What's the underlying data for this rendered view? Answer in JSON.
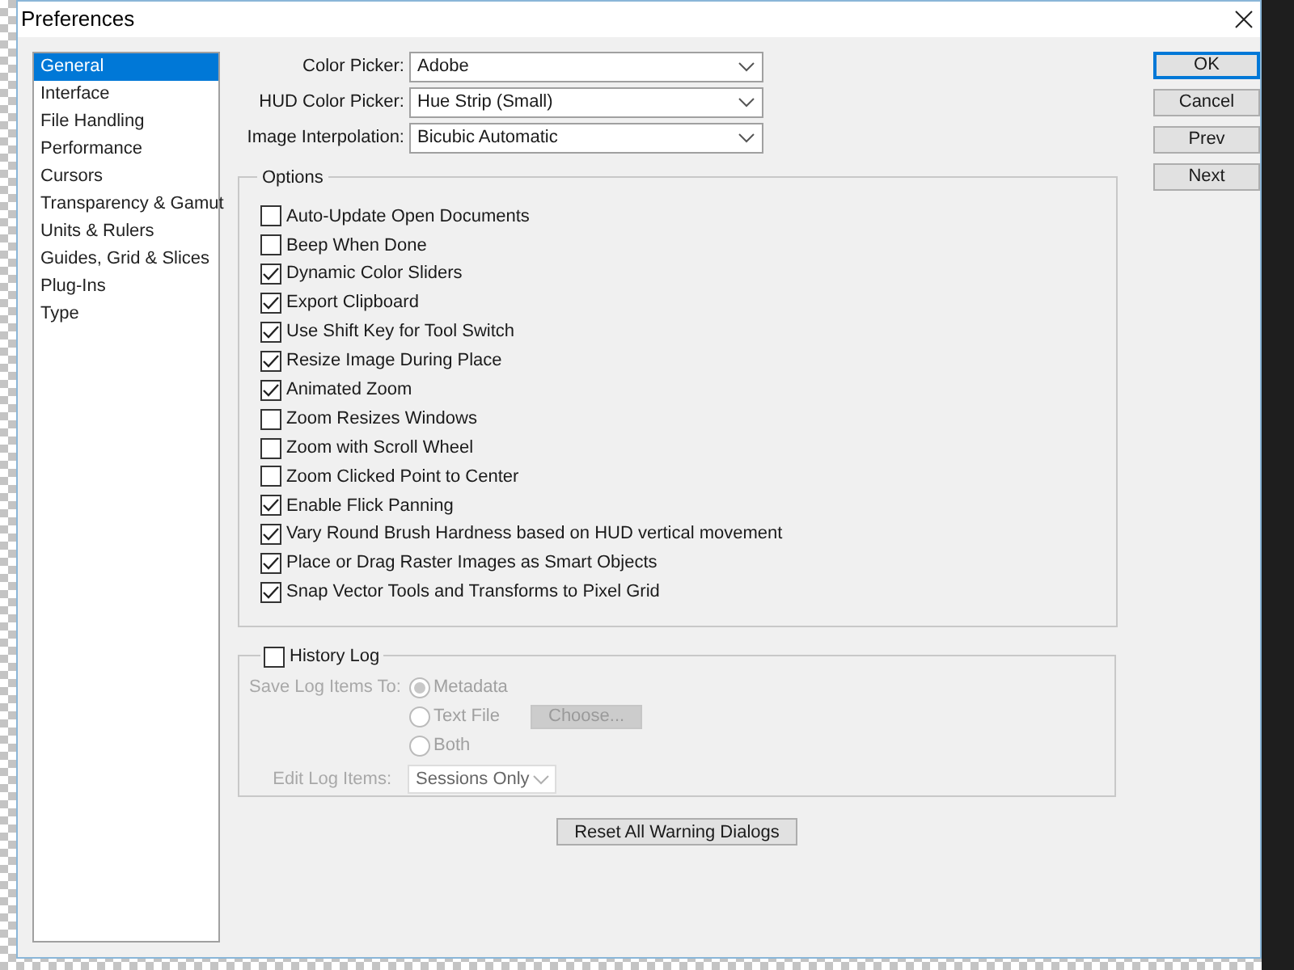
{
  "window": {
    "title": "Preferences"
  },
  "sidebar": {
    "items": [
      {
        "label": "General",
        "selected": true
      },
      {
        "label": "Interface",
        "selected": false
      },
      {
        "label": "File Handling",
        "selected": false
      },
      {
        "label": "Performance",
        "selected": false
      },
      {
        "label": "Cursors",
        "selected": false
      },
      {
        "label": "Transparency & Gamut",
        "selected": false
      },
      {
        "label": "Units & Rulers",
        "selected": false
      },
      {
        "label": "Guides, Grid & Slices",
        "selected": false
      },
      {
        "label": "Plug-Ins",
        "selected": false
      },
      {
        "label": "Type",
        "selected": false
      }
    ]
  },
  "pickers": [
    {
      "label": "Color Picker:",
      "value": "Adobe"
    },
    {
      "label": "HUD Color Picker:",
      "value": "Hue Strip (Small)"
    },
    {
      "label": "Image Interpolation:",
      "value": "Bicubic Automatic"
    }
  ],
  "options": {
    "title": "Options",
    "items": [
      {
        "label": "Auto-Update Open Documents",
        "checked": false
      },
      {
        "label": "Beep When Done",
        "checked": false
      },
      {
        "label": "Dynamic Color Sliders",
        "checked": true
      },
      {
        "label": "Export Clipboard",
        "checked": true
      },
      {
        "label": "Use Shift Key for Tool Switch",
        "checked": true
      },
      {
        "label": "Resize Image During Place",
        "checked": true
      },
      {
        "label": "Animated Zoom",
        "checked": true
      },
      {
        "label": "Zoom Resizes Windows",
        "checked": false
      },
      {
        "label": "Zoom with Scroll Wheel",
        "checked": false
      },
      {
        "label": "Zoom Clicked Point to Center",
        "checked": false
      },
      {
        "label": "Enable Flick Panning",
        "checked": true
      },
      {
        "label": "Vary Round Brush Hardness based on HUD vertical movement",
        "checked": true
      },
      {
        "label": "Place or Drag Raster Images as Smart Objects",
        "checked": true
      },
      {
        "label": "Snap Vector Tools and Transforms to Pixel Grid",
        "checked": true
      }
    ]
  },
  "history_log": {
    "label": "History Log",
    "checked": false,
    "disabled": true,
    "save_label": "Save Log Items To:",
    "save_options": [
      {
        "label": "Metadata",
        "selected": true
      },
      {
        "label": "Text File",
        "selected": false
      },
      {
        "label": "Both",
        "selected": false
      }
    ],
    "choose_button": "Choose...",
    "edit_label": "Edit Log Items:",
    "edit_value": "Sessions Only"
  },
  "reset_button": "Reset All Warning Dialogs",
  "buttons": [
    {
      "label": "OK",
      "selected": true
    },
    {
      "label": "Cancel",
      "selected": false
    },
    {
      "label": "Prev",
      "selected": false
    },
    {
      "label": "Next",
      "selected": false
    }
  ]
}
